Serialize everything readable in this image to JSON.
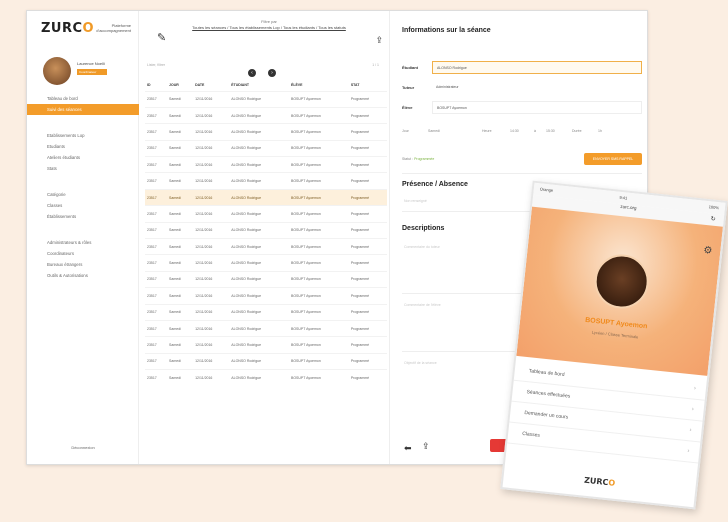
{
  "brand": {
    "name": "ZURC",
    "accent_letter": "O",
    "accent": "#f39c2a",
    "tagline": "Plateforme d'accompagnement"
  },
  "user": {
    "name": "Laurence Noelli",
    "role": "Coordinateur"
  },
  "sidebar": {
    "items": [
      {
        "label": "Tableau de bord",
        "active": false,
        "gap_before": false
      },
      {
        "label": "Suivi des séances",
        "active": true,
        "gap_before": false
      },
      {
        "label": "Etablissements Lop",
        "active": false,
        "gap_before": true
      },
      {
        "label": "Etudiants",
        "active": false,
        "gap_before": false
      },
      {
        "label": "Ateliers étudiants",
        "active": false,
        "gap_before": false
      },
      {
        "label": "Stats",
        "active": false,
        "gap_before": false
      },
      {
        "label": "Catégorie",
        "active": false,
        "gap_before": true
      },
      {
        "label": "Classes",
        "active": false,
        "gap_before": false
      },
      {
        "label": "Établissements",
        "active": false,
        "gap_before": false
      },
      {
        "label": "Administrateurs & rôles",
        "active": false,
        "gap_before": true
      },
      {
        "label": "Coordinateurs",
        "active": false,
        "gap_before": false
      },
      {
        "label": "Bureaux étrangers",
        "active": false,
        "gap_before": false
      },
      {
        "label": "Outils & Autorisations",
        "active": false,
        "gap_before": false
      }
    ],
    "logout": "Déconnexion"
  },
  "toolbar": {
    "filter_label": "Filtre par",
    "filter_links": "Toutes les séances / Tous les établissements Lop / Tous les étudiants / Tous les statuts",
    "search_placeholder": "Lister, filtrer",
    "pager_prev": "‹",
    "pager_next": "›",
    "pager_info": "1 / 1"
  },
  "table": {
    "headers": [
      "ID",
      "JOUR",
      "DATE",
      "ÉTUDIANT",
      "ÉLÈVE",
      "STAT"
    ],
    "rows": [
      [
        "23517",
        "Samedi",
        "12/11/2016",
        "ALONSO Rodrigue",
        "BOSUPT Ayoemon",
        "Programmé",
        false
      ],
      [
        "23517",
        "Samedi",
        "12/11/2016",
        "ALONSO Rodrigue",
        "BOSUPT Ayoemon",
        "Programmé",
        false
      ],
      [
        "23517",
        "Samedi",
        "12/11/2016",
        "ALONSO Rodrigue",
        "BOSUPT Ayoemon",
        "Programmé",
        false
      ],
      [
        "23517",
        "Samedi",
        "12/11/2016",
        "ALONSO Rodrigue",
        "BOSUPT Ayoemon",
        "Programmé",
        false
      ],
      [
        "23517",
        "Samedi",
        "12/11/2016",
        "ALONSO Rodrigue",
        "BOSUPT Ayoemon",
        "Programmé",
        false
      ],
      [
        "23517",
        "Samedi",
        "12/11/2016",
        "ALONSO Rodrigue",
        "BOSUPT Ayoemon",
        "Programmé",
        false
      ],
      [
        "23517",
        "Samedi",
        "12/11/2016",
        "ALONSO Rodrigue",
        "BOSUPT Ayoemon",
        "Programmé",
        true
      ],
      [
        "23517",
        "Samedi",
        "12/11/2016",
        "ALONSO Rodrigue",
        "BOSUPT Ayoemon",
        "Programmé",
        false
      ],
      [
        "23517",
        "Samedi",
        "12/11/2016",
        "ALONSO Rodrigue",
        "BOSUPT Ayoemon",
        "Programmé",
        false
      ],
      [
        "23517",
        "Samedi",
        "12/11/2016",
        "ALONSO Rodrigue",
        "BOSUPT Ayoemon",
        "Programmé",
        false
      ],
      [
        "23517",
        "Samedi",
        "12/11/2016",
        "ALONSO Rodrigue",
        "BOSUPT Ayoemon",
        "Programmé",
        false
      ],
      [
        "23517",
        "Samedi",
        "12/11/2016",
        "ALONSO Rodrigue",
        "BOSUPT Ayoemon",
        "Programmé",
        false
      ],
      [
        "23517",
        "Samedi",
        "12/11/2016",
        "ALONSO Rodrigue",
        "BOSUPT Ayoemon",
        "Programmé",
        false
      ],
      [
        "23517",
        "Samedi",
        "12/11/2016",
        "ALONSO Rodrigue",
        "BOSUPT Ayoemon",
        "Programmé",
        false
      ],
      [
        "23517",
        "Samedi",
        "12/11/2016",
        "ALONSO Rodrigue",
        "BOSUPT Ayoemon",
        "Programmé",
        false
      ],
      [
        "23517",
        "Samedi",
        "12/11/2016",
        "ALONSO Rodrigue",
        "BOSUPT Ayoemon",
        "Programmé",
        false
      ],
      [
        "23517",
        "Samedi",
        "12/11/2016",
        "ALONSO Rodrigue",
        "BOSUPT Ayoemon",
        "Programmé",
        false
      ],
      [
        "23517",
        "Samedi",
        "12/11/2016",
        "ALONSO Rodrigue",
        "BOSUPT Ayoemon",
        "Programmé",
        false
      ]
    ]
  },
  "panel": {
    "title": "Informations sur la séance",
    "student_label": "Étudiant",
    "student_value": "ALONSO Rodrigue",
    "tutor_label": "Tuteur",
    "tutor_value": "Administrateur",
    "pupil_label": "Élève",
    "pupil_value": "BOSUPT Ayoemon",
    "time_row": [
      "Jour",
      "Samedi",
      "Heure",
      "14:30",
      "à",
      "15:30",
      "Durée",
      "1h"
    ],
    "status_label": "Statut :",
    "status_value": "Programmée",
    "action_button": "ENVOYER SMS RAPPEL",
    "presence_title": "Présence / Absence",
    "presence_placeholder": "Non renseigné",
    "descriptions_title": "Descriptions",
    "desc_placeholder1": "Commentaire du tuteur",
    "desc_placeholder2": "Commentaire de l'élève",
    "desc_placeholder3": "Objectif de la séance",
    "delete_button": "SUPPRIMER"
  },
  "mobile": {
    "carrier": "Orange",
    "time": "9:41",
    "battery": "100%",
    "url": "zurc.org",
    "name": "BOSUPT Ayoemon",
    "role": "Lycéen / Classe Terminale",
    "menu": [
      "Tableau de bord",
      "Séances effectuées",
      "Demander un cours",
      "Classes"
    ]
  }
}
